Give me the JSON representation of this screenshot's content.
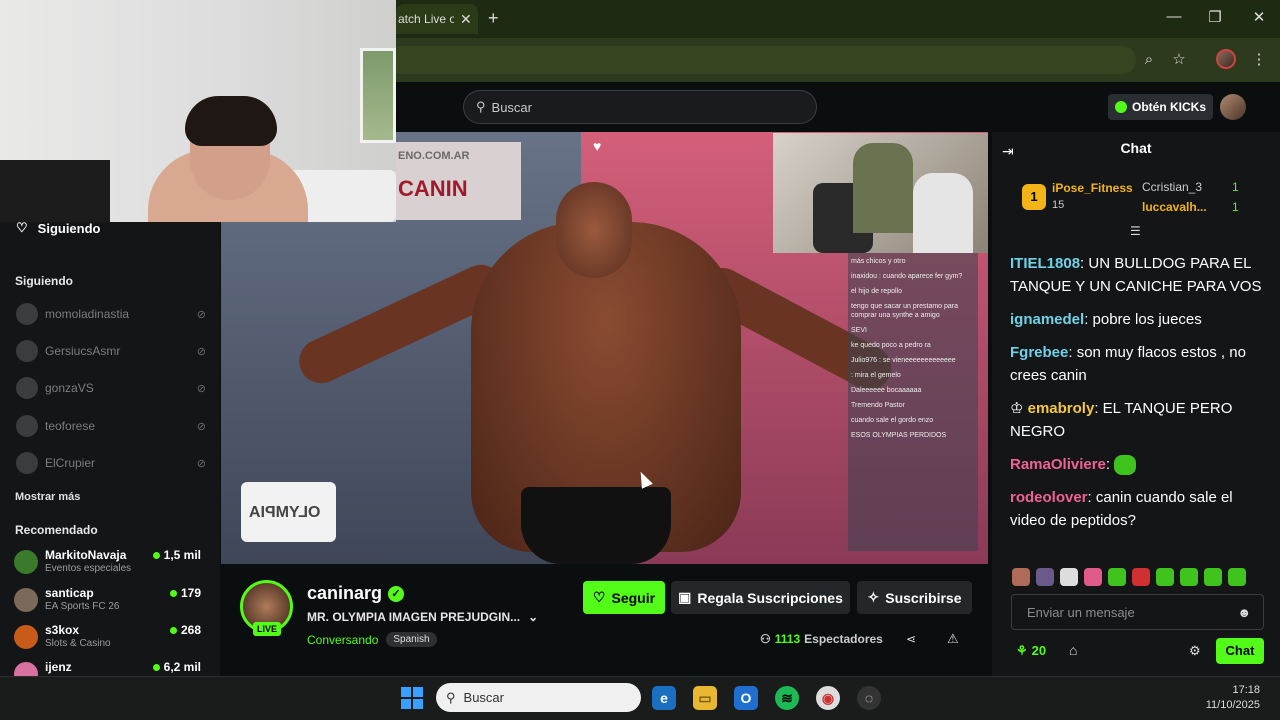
{
  "browser": {
    "tab_title": "atch Live o",
    "new_tab": "+",
    "window_controls": [
      "—",
      "❐",
      "✕"
    ]
  },
  "header": {
    "search_placeholder": "Buscar",
    "kicks_button": "Obtén KICKs"
  },
  "sidebar": {
    "following_top": "Siguiendo",
    "following_heading": "Siguiendo",
    "following": [
      "momoladinastia",
      "GersiucsAsmr",
      "gonzaVS",
      "teoforese",
      "ElCrupier"
    ],
    "show_more": "Mostrar más",
    "recommended_heading": "Recomendado",
    "recommended": [
      {
        "name": "MarkitoNavaja",
        "category": "Eventos especiales",
        "viewers": "1,5 mil"
      },
      {
        "name": "santicap",
        "category": "EA Sports FC 26",
        "viewers": "179"
      },
      {
        "name": "s3kox",
        "category": "Slots & Casino",
        "viewers": "268"
      },
      {
        "name": "ijenz",
        "category": "",
        "viewers": "6,2 mil"
      }
    ]
  },
  "video": {
    "banner_url": "ENO.COM.AR",
    "banner_text": "CANIN",
    "olympia_logo": "OLYMPIA",
    "overlay_chat": [
      "más chicos y otro",
      "",
      "inaxidou : cuando aparece fer gym?",
      "el hijo de repollo",
      "tengo que sacar un prestamo para comprar una synthe a amigo",
      "SEVI",
      "ke quedo poco a pedro ra",
      "Julio976 : se vieneeeeeeeeeeeee",
      ": mira el gemelo",
      "Daleeeeee bocaaaaaa",
      "Tremendo Pastor",
      "cuando sale el gordo enzo",
      "ESOS OLYMPIAS PERDIDOS"
    ]
  },
  "stream": {
    "live_badge": "LIVE",
    "streamer": "caninarg",
    "title": "MR. OLYMPIA IMAGEN PREJUDGIN...",
    "category": "Conversando",
    "language": "Spanish",
    "follow": "Seguir",
    "gift_subs": "Regala Suscripciones",
    "subscribe": "Suscribirse",
    "viewers": "1113",
    "viewers_label": "Espectadores"
  },
  "chat": {
    "title": "Chat",
    "gifters": {
      "top_rank": "1",
      "top_name": "iPose_Fitness",
      "top_count": "15",
      "second_name": "Ccristian_3",
      "second_count": "1",
      "third_name": "luccavalh...",
      "third_count": "1"
    },
    "messages": [
      {
        "user": "ITIEL1808",
        "color": "#6fd3e8",
        "text": ": UN BULLDOG PARA EL TANQUE Y UN CANICHE PARA VOS"
      },
      {
        "user": "ignamedel",
        "color": "#6fd3e8",
        "text": ": pobre los jueces"
      },
      {
        "user": "Fgrebee",
        "color": "#6fd3e8",
        "text": ": son muy flacos estos , no crees canin"
      },
      {
        "user": "emabroly",
        "color": "#f5c842",
        "text": ": EL TANQUE PERO NEGRO"
      },
      {
        "user": "RamaOliviere",
        "color": "#f06292",
        "text": ":"
      },
      {
        "user": "rodeolover",
        "color": "#f06292",
        "text": ": canin cuando sale el video de peptidos?"
      }
    ],
    "input_placeholder": "Enviar un mensaje",
    "kicks_count": "20",
    "send_button": "Chat"
  },
  "taskbar": {
    "search_placeholder": "Buscar",
    "time": "17:18",
    "date": "11/10/2025"
  }
}
